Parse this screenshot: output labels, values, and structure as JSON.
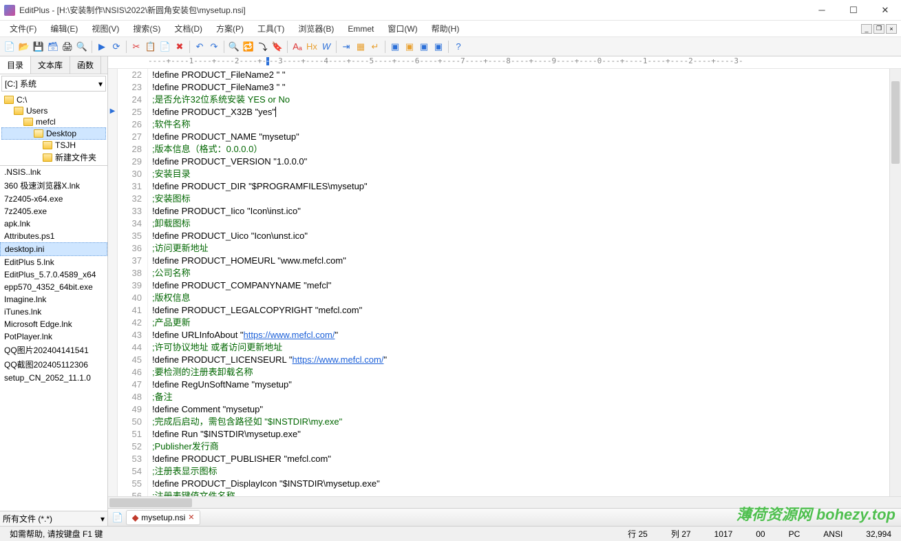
{
  "title": "EditPlus - [H:\\安装制作\\NSIS\\2022\\新圆角安装包\\mysetup.nsi]",
  "menu": [
    "文件(F)",
    "编辑(E)",
    "视图(V)",
    "搜索(S)",
    "文档(D)",
    "方案(P)",
    "工具(T)",
    "浏览器(B)",
    "Emmet",
    "窗口(W)",
    "帮助(H)"
  ],
  "side_tabs": [
    "目录",
    "文本库",
    "函数"
  ],
  "drive": "[C:] 系统",
  "folders": [
    {
      "label": "C:\\",
      "indent": 0,
      "open": false
    },
    {
      "label": "Users",
      "indent": 1,
      "open": false
    },
    {
      "label": "mefcl",
      "indent": 2,
      "open": false
    },
    {
      "label": "Desktop",
      "indent": 3,
      "open": true,
      "sel": true
    },
    {
      "label": "TSJH",
      "indent": 4,
      "open": false
    },
    {
      "label": "新建文件夹",
      "indent": 4,
      "open": false
    }
  ],
  "files": [
    ".NSIS..lnk",
    "360 极速浏览器X.lnk",
    "7z2405-x64.exe",
    "7z2405.exe",
    "apk.lnk",
    "Attributes.ps1",
    "desktop.ini",
    "EditPlus 5.lnk",
    "EditPlus_5.7.0.4589_x64",
    "epp570_4352_64bit.exe",
    "Imagine.lnk",
    "iTunes.lnk",
    "Microsoft Edge.lnk",
    "PotPlayer.lnk",
    "QQ图片202404141541",
    "QQ截图202405112306",
    "setup_CN_2052_11.1.0"
  ],
  "file_sel": "desktop.ini",
  "filter": "所有文件 (*.*)",
  "ruler": "----+----1----+----2----+----3----+----4----+----5----+----6----+----7----+----8----+----9----+----0----+----1----+----2----+----3-",
  "code": {
    "start": 22,
    "arrow_line": 25,
    "lines": [
      {
        "t": "!define PRODUCT_FileName2 \" \""
      },
      {
        "t": "!define PRODUCT_FileName3 \" \""
      },
      {
        "t": ";是否允许32位系统安装 YES or No",
        "c": true
      },
      {
        "t": "!define PRODUCT_X32B \"yes\"",
        "cursor": true
      },
      {
        "t": ";软件名称",
        "c": true
      },
      {
        "t": "!define PRODUCT_NAME \"mysetup\""
      },
      {
        "t": ";版本信息（格式：0.0.0.0）",
        "c": true
      },
      {
        "t": "!define PRODUCT_VERSION \"1.0.0.0\""
      },
      {
        "t": ";安装目录",
        "c": true
      },
      {
        "t": "!define PRODUCT_DIR \"$PROGRAMFILES\\mysetup\""
      },
      {
        "t": ";安装图标",
        "c": true
      },
      {
        "t": "!define PRODUCT_Iico \"Icon\\inst.ico\""
      },
      {
        "t": ";卸载图标",
        "c": true
      },
      {
        "t": "!define PRODUCT_Uico \"Icon\\unst.ico\""
      },
      {
        "t": ";访问更新地址",
        "c": true
      },
      {
        "t": "!define PRODUCT_HOMEURL \"www.mefcl.com\""
      },
      {
        "t": ";公司名称",
        "c": true
      },
      {
        "t": "!define PRODUCT_COMPANYNAME \"mefcl\""
      },
      {
        "t": ";版权信息",
        "c": true
      },
      {
        "t": "!define PRODUCT_LEGALCOPYRIGHT \"mefcl.com\""
      },
      {
        "t": ";产品更新",
        "c": true
      },
      {
        "pre": "!define URLInfoAbout \"",
        "link": "https://www.mefcl.com/",
        "post": "\""
      },
      {
        "t": ";许可协议地址 或者访问更新地址",
        "c": true
      },
      {
        "pre": "!define PRODUCT_LICENSEURL \"",
        "link": "https://www.mefcl.com/",
        "post": "\""
      },
      {
        "t": ";要检测的注册表卸载名称",
        "c": true
      },
      {
        "t": "!define RegUnSoftName \"mysetup\""
      },
      {
        "t": ";备注",
        "c": true
      },
      {
        "t": "!define Comment \"mysetup\""
      },
      {
        "t": ";完成后启动，需包含路径如 \"$INSTDIR\\my.exe\"",
        "c": true
      },
      {
        "t": "!define Run \"$INSTDIR\\mysetup.exe\""
      },
      {
        "t": ";Publisher发行商",
        "c": true
      },
      {
        "t": "!define PRODUCT_PUBLISHER \"mefcl.com\""
      },
      {
        "t": ";注册表显示图标",
        "c": true
      },
      {
        "t": "!define PRODUCT_DisplayIcon \"$INSTDIR\\mysetup.exe\""
      },
      {
        "t": ";注册表键值文件名称",
        "c": true
      }
    ]
  },
  "doctab": {
    "name": "mysetup.nsi",
    "modified": true
  },
  "status": {
    "help": "如需帮助, 请按键盘 F1 键",
    "line": "行 25",
    "col": "列 27",
    "pos": "1017",
    "sel": "00",
    "ins": "PC",
    "enc": "ANSI",
    "size": "32,994"
  },
  "watermark": "薄荷资源网  bohezy.top"
}
